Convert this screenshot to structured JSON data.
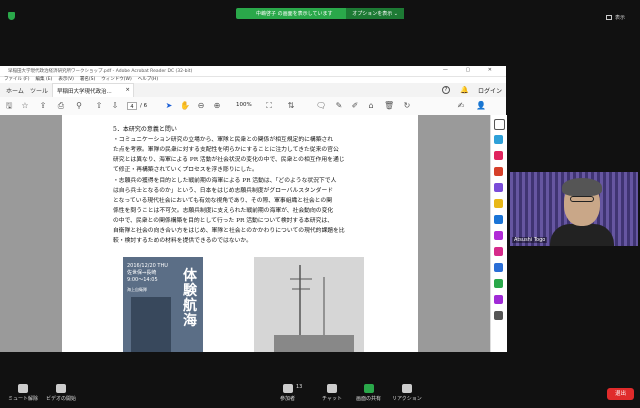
{
  "share": {
    "status_text": "中嶋啓子 の画面を表示しています",
    "options_label": "オプションを表示 ⌄"
  },
  "topright": {
    "view_label": "表示"
  },
  "acrobat": {
    "window_title": "早稲田大学現代政治経済研究所ワークショップ.pdf - Adobe Acrobat Reader DC (32-bit)",
    "menu": [
      "ファイル (F)",
      "編集 (E)",
      "表示(V)",
      "署名(S)",
      "ウィンドウ(W)",
      "ヘルプ(H)"
    ],
    "tabs": {
      "home": "ホーム",
      "tools": "ツール",
      "doc": "早稲田大学現代政治..."
    },
    "help": "?",
    "login": "ログイン",
    "page_current": "4",
    "page_total": "/ 6",
    "zoom": "100%"
  },
  "pdf": {
    "heading": "5．本研究の意義と問い",
    "para1": [
      "・コミュニケーション研究の立場から、軍隊と民衆との関係が相互規定的に構築され",
      "た点を考察。軍隊の民衆に対する支配性を明らかにすることに注力してきた従来の官公",
      "研究とは異なり、海軍による PR 活動が社会状況の変化の中で、民衆との相互作用を通じ",
      "て修正・再構築されていくプロセスを浮き彫りにした。"
    ],
    "para2": [
      "・志願兵の獲得を目的とした戦前期の海軍による PR 活動は、「どのような状況下で人",
      "は自ら兵士となるのか」という、日本をはじめ志願兵制度がグローバルスタンダード",
      "となっている現代社会においても有効な視角であり、その際、軍事組織と社会との関",
      "係性を問うことは不可欠。志願兵制度に支えられた戦前期の海軍が、社会動向の変化",
      "の中で、民衆との関係構築を目的として行った PR 活動について検討する本研究は、",
      "自衛隊と社会の向き合い方をはじめ、軍隊と社会とのかかわりについての現代的課題を比",
      "較・検討するための材料を提供できるのではないか。"
    ],
    "poster": {
      "date": "2016/12/20 THU\n佐世保⇒長崎\n9:00～14:05",
      "title": "体験航海",
      "org": "海上自衛隊"
    }
  },
  "participant": {
    "name": "Atsushi Togo"
  },
  "bottom": {
    "mute": "ミュート解除",
    "video": "ビデオの開始",
    "participants": "参加者",
    "participants_count": "13",
    "chat": "チャット",
    "share": "画面の共有",
    "reaction": "リアクション",
    "end": "退出"
  }
}
